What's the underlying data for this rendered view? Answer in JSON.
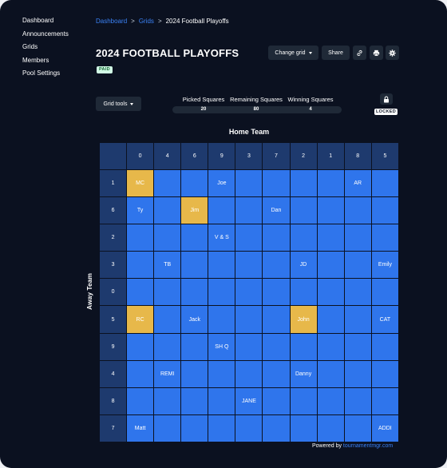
{
  "sidebar": {
    "items": [
      {
        "label": "Dashboard"
      },
      {
        "label": "Announcements"
      },
      {
        "label": "Grids"
      },
      {
        "label": "Members"
      },
      {
        "label": "Pool Settings"
      }
    ]
  },
  "breadcrumb": {
    "items": [
      "Dashboard",
      "Grids",
      "2024 Football Playoffs"
    ],
    "separator": ">"
  },
  "page": {
    "title": "2024 FOOTBALL PLAYOFFS",
    "badge": "PAID"
  },
  "toolbar": {
    "change_grid_label": "Change grid",
    "share_label": "Share",
    "icons": [
      "link-icon",
      "print-icon",
      "gear-icon"
    ]
  },
  "grid_tools": {
    "label": "Grid tools"
  },
  "stats": [
    {
      "label": "Picked Squares",
      "value": "20"
    },
    {
      "label": "Remaining Squares",
      "value": "80"
    },
    {
      "label": "Winning Squares",
      "value": "4"
    }
  ],
  "lock": {
    "icon": "lock-icon",
    "status": "LOCKED"
  },
  "grid": {
    "home_label": "Home Team",
    "away_label": "Away Team",
    "home_numbers": [
      "0",
      "4",
      "6",
      "9",
      "3",
      "7",
      "2",
      "1",
      "8",
      "5"
    ],
    "away_numbers": [
      "1",
      "6",
      "2",
      "3",
      "0",
      "5",
      "9",
      "4",
      "8",
      "7"
    ],
    "colors": {
      "open": "#2f75ec",
      "winner": "#e7b84a",
      "header": "#1e3a6e"
    },
    "rows": [
      [
        {
          "name": "MC",
          "winner": true
        },
        {
          "name": ""
        },
        {
          "name": ""
        },
        {
          "name": "Joe"
        },
        {
          "name": ""
        },
        {
          "name": ""
        },
        {
          "name": ""
        },
        {
          "name": ""
        },
        {
          "name": "AR"
        },
        {
          "name": ""
        }
      ],
      [
        {
          "name": "Ty"
        },
        {
          "name": ""
        },
        {
          "name": "Jim",
          "winner": true
        },
        {
          "name": ""
        },
        {
          "name": ""
        },
        {
          "name": "Dan"
        },
        {
          "name": ""
        },
        {
          "name": ""
        },
        {
          "name": ""
        },
        {
          "name": ""
        }
      ],
      [
        {
          "name": ""
        },
        {
          "name": ""
        },
        {
          "name": ""
        },
        {
          "name": "V & S"
        },
        {
          "name": ""
        },
        {
          "name": ""
        },
        {
          "name": ""
        },
        {
          "name": ""
        },
        {
          "name": ""
        },
        {
          "name": ""
        }
      ],
      [
        {
          "name": ""
        },
        {
          "name": "TB"
        },
        {
          "name": ""
        },
        {
          "name": ""
        },
        {
          "name": ""
        },
        {
          "name": ""
        },
        {
          "name": "JD"
        },
        {
          "name": ""
        },
        {
          "name": ""
        },
        {
          "name": "Emily"
        }
      ],
      [
        {
          "name": ""
        },
        {
          "name": ""
        },
        {
          "name": ""
        },
        {
          "name": ""
        },
        {
          "name": ""
        },
        {
          "name": ""
        },
        {
          "name": ""
        },
        {
          "name": ""
        },
        {
          "name": ""
        },
        {
          "name": ""
        }
      ],
      [
        {
          "name": "RC",
          "winner": true
        },
        {
          "name": ""
        },
        {
          "name": "Jack"
        },
        {
          "name": ""
        },
        {
          "name": ""
        },
        {
          "name": ""
        },
        {
          "name": "John",
          "winner": true
        },
        {
          "name": ""
        },
        {
          "name": ""
        },
        {
          "name": "CAT"
        }
      ],
      [
        {
          "name": ""
        },
        {
          "name": ""
        },
        {
          "name": ""
        },
        {
          "name": "SH Q"
        },
        {
          "name": ""
        },
        {
          "name": ""
        },
        {
          "name": ""
        },
        {
          "name": ""
        },
        {
          "name": ""
        },
        {
          "name": ""
        }
      ],
      [
        {
          "name": ""
        },
        {
          "name": "REMI"
        },
        {
          "name": ""
        },
        {
          "name": ""
        },
        {
          "name": ""
        },
        {
          "name": ""
        },
        {
          "name": "Danny"
        },
        {
          "name": ""
        },
        {
          "name": ""
        },
        {
          "name": ""
        }
      ],
      [
        {
          "name": ""
        },
        {
          "name": ""
        },
        {
          "name": ""
        },
        {
          "name": ""
        },
        {
          "name": "JANE"
        },
        {
          "name": ""
        },
        {
          "name": ""
        },
        {
          "name": ""
        },
        {
          "name": ""
        },
        {
          "name": ""
        }
      ],
      [
        {
          "name": "Matt"
        },
        {
          "name": ""
        },
        {
          "name": ""
        },
        {
          "name": ""
        },
        {
          "name": ""
        },
        {
          "name": ""
        },
        {
          "name": ""
        },
        {
          "name": ""
        },
        {
          "name": ""
        },
        {
          "name": "ADDI"
        }
      ]
    ]
  },
  "footer": {
    "powered_label": "Powered by",
    "link_text": "tournamentmgr.com"
  }
}
